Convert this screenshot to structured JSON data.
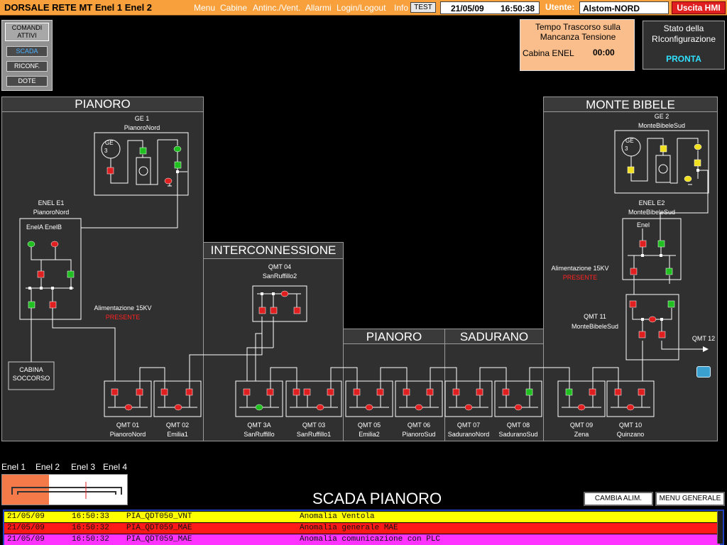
{
  "topbar": {
    "title": "DORSALE RETE MT Enel 1 Enel 2",
    "menus": [
      "Menu",
      "Cabine",
      "Antinc./Vent.",
      "Allarmi",
      "Login/Logout",
      "Info"
    ],
    "test_label": "TEST",
    "date": "21/05/09",
    "time": "16:50:38",
    "utente_label": "Utente:",
    "utente_value": "Alstom-NORD",
    "exit_label": "Uscita HMI"
  },
  "commands": {
    "title": "COMANDI ATTIVI",
    "items": [
      "SCADA",
      "RICONF.",
      "DOTE"
    ]
  },
  "tempo": {
    "title": "Tempo Trascorso sulla Mancanza Tensione",
    "cabina_label": "Cabina ENEL",
    "value": "00:00"
  },
  "stato": {
    "title": "Stato della RIconfigurazione",
    "value": "PRONTA"
  },
  "areas": {
    "pianoro_left": "PIANORO",
    "interconnessione": "INTERCONNESSIONE",
    "pianoro_mid": "PIANORO",
    "sadurano": "SADURANO",
    "monte_bibele": "MONTE BIBELE"
  },
  "stations": {
    "ge1": {
      "name": "GE 1",
      "sub": "PianoroNord"
    },
    "ge2": {
      "name": "GE 2",
      "sub": "MonteBibeleSud"
    },
    "enel_e1": {
      "name": "ENEL E1",
      "sub": "PianoroNord",
      "inner": "EnelA EnelB"
    },
    "enel_e2": {
      "name": "ENEL E2",
      "sub": "MonteBibeleSud",
      "inner": "Enel"
    },
    "qmt04": {
      "name": "QMT 04",
      "sub": "SanRuffillo2"
    },
    "qmt11": {
      "name": "QMT 11",
      "sub": "MonteBibeleSud"
    },
    "qmt12": "QMT 12",
    "cabina_soccorso": "CABINA SOCCORSO",
    "alim_left": {
      "label": "Alimentazione 15KV",
      "state": "PRESENTE"
    },
    "alim_right": {
      "label": "Alimentazione 15KV",
      "state": "PRESENTE"
    },
    "ge_symbol": "GE",
    "ge_symbol_num": "3",
    "bottom": [
      {
        "name": "QMT 01",
        "sub": "PianoroNord"
      },
      {
        "name": "QMT 02",
        "sub": "Emilia1"
      },
      {
        "name": "QMT 3A",
        "sub": "SanRuffillo"
      },
      {
        "name": "QMT 03",
        "sub": "SanRuffillo1"
      },
      {
        "name": "QMT 05",
        "sub": "Emilia2"
      },
      {
        "name": "QMT 06",
        "sub": "PianoroSud"
      },
      {
        "name": "QMT 07",
        "sub": "SaduranoNord"
      },
      {
        "name": "QMT 08",
        "sub": "SaduranoSud"
      },
      {
        "name": "QMT 09",
        "sub": "Zena"
      },
      {
        "name": "QMT 10",
        "sub": "Quinzano"
      }
    ]
  },
  "enel_strip": {
    "labels": [
      "Enel 1",
      "Enel 2",
      "Enel 3",
      "Enel 4"
    ]
  },
  "footer": {
    "scada_title": "SCADA PIANORO",
    "btn_cambia": "CAMBIA ALIM.",
    "btn_menu": "MENU GENERALE"
  },
  "alarms": [
    {
      "date": "21/05/09",
      "time": "16:50:33",
      "tag": "PIA_QDT050_VNT",
      "desc": "Anomalia Ventola",
      "color": "#ffff00"
    },
    {
      "date": "21/05/09",
      "time": "16:50:32",
      "tag": "PIA_QDT059_MAE",
      "desc": "Anomalia generale MAE",
      "color": "#ff1a1a"
    },
    {
      "date": "21/05/09",
      "time": "16:50:32",
      "tag": "PIA_QDT059_MAE",
      "desc": "Anomalia comunicazione con PLC",
      "color": "#ff33ff"
    }
  ],
  "colors": {
    "closed": "#e02020",
    "open": "#20c020",
    "unknown": "#f0e020",
    "accent": "#f7a03c"
  }
}
